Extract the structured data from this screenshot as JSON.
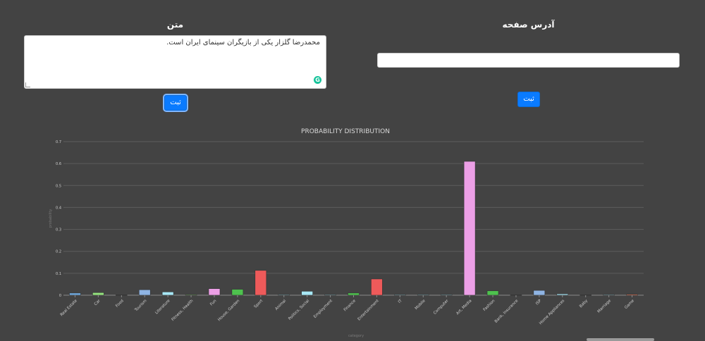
{
  "form": {
    "text_label": "متن",
    "text_value": "محمدرضا گلزار یکی از بازیگران سینمای ایران است.",
    "url_label": "آدرس صفحه",
    "url_value": "",
    "submit_label": "ثبت",
    "grammarly_glyph": "G"
  },
  "chart_data": {
    "type": "bar",
    "title": "PROBABILITY DISTRIBUTION",
    "xlabel": "category",
    "ylabel": "probability",
    "ylim": [
      0,
      0.7
    ],
    "yticks": [
      0,
      0.1,
      0.2,
      0.3,
      0.4,
      0.5,
      0.6,
      0.7
    ],
    "grid": true,
    "categories": [
      "Real Estate",
      "Car",
      "Food",
      "Tourism",
      "Literature",
      "Fitness, Health",
      "Fun",
      "House, Garden",
      "Sport",
      "Animal",
      "Politics, Social",
      "Employment",
      "Finance",
      "Entertainment",
      "IT",
      "Mobile",
      "Computer",
      "Art, Media",
      "Fashion",
      "Bank, Insurance",
      "ISP",
      "Home Appliances",
      "Baby",
      "Marriage",
      "Game"
    ],
    "values": [
      0.01,
      0.012,
      0.001,
      0.025,
      0.015,
      0.003,
      0.03,
      0.027,
      0.113,
      0.003,
      0.018,
      0.003,
      0.01,
      0.074,
      0.003,
      0.003,
      0.003,
      0.61,
      0.02,
      0.001,
      0.022,
      0.006,
      0.001,
      0.003,
      0.004
    ],
    "colors": [
      "#6fa8dc",
      "#93e07d",
      "#93e07d",
      "#8fb4e3",
      "#a7e7f5",
      "#93e07d",
      "#ec9fe6",
      "#4ec24e",
      "#ee5a5a",
      "#a7e7f5",
      "#a7e7f5",
      "#a7e7f5",
      "#4ec24e",
      "#ee5a5a",
      "#a7e7f5",
      "#a7e7f5",
      "#a7e7f5",
      "#ec9fe6",
      "#4ec24e",
      "#a7e7f5",
      "#8fb4e3",
      "#a7e7f5",
      "#a7e7f5",
      "#a7e7f5",
      "#ee7b5a"
    ]
  }
}
